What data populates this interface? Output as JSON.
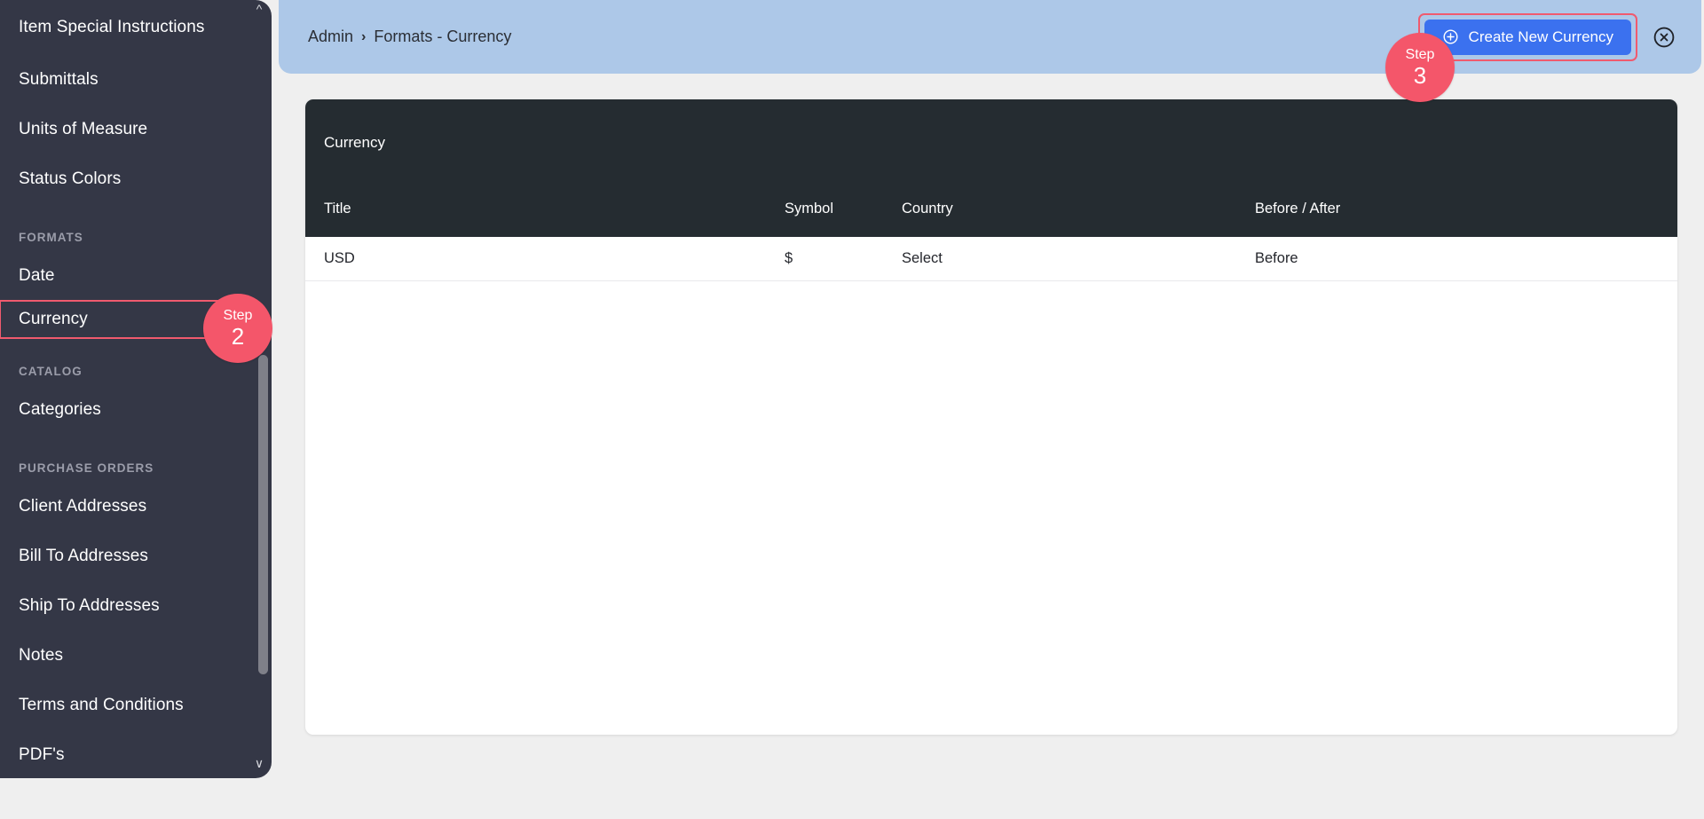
{
  "sidebar": {
    "items": [
      {
        "label": "Item Special Instructions",
        "type": "item",
        "name": "sidebar-item-item-special-instructions"
      },
      {
        "label": "Submittals",
        "type": "item",
        "name": "sidebar-item-submittals"
      },
      {
        "label": "Units of Measure",
        "type": "item",
        "name": "sidebar-item-units-of-measure"
      },
      {
        "label": "Status Colors",
        "type": "item",
        "name": "sidebar-item-status-colors"
      },
      {
        "label": "FORMATS",
        "type": "section",
        "name": "sidebar-section-formats"
      },
      {
        "label": "Date",
        "type": "item",
        "name": "sidebar-item-date"
      },
      {
        "label": "Currency",
        "type": "item",
        "highlighted": true,
        "name": "sidebar-item-currency"
      },
      {
        "label": "CATALOG",
        "type": "section",
        "name": "sidebar-section-catalog"
      },
      {
        "label": "Categories",
        "type": "item",
        "name": "sidebar-item-categories"
      },
      {
        "label": "PURCHASE ORDERS",
        "type": "section",
        "name": "sidebar-section-purchase-orders"
      },
      {
        "label": "Client Addresses",
        "type": "item",
        "name": "sidebar-item-client-addresses"
      },
      {
        "label": "Bill To Addresses",
        "type": "item",
        "name": "sidebar-item-bill-to-addresses"
      },
      {
        "label": "Ship To Addresses",
        "type": "item",
        "name": "sidebar-item-ship-to-addresses"
      },
      {
        "label": "Notes",
        "type": "item",
        "name": "sidebar-item-notes"
      },
      {
        "label": "Terms and Conditions",
        "type": "item",
        "name": "sidebar-item-terms-and-conditions"
      },
      {
        "label": "PDF's",
        "type": "item",
        "name": "sidebar-item-pdfs"
      }
    ]
  },
  "header": {
    "breadcrumb": {
      "root": "Admin",
      "separator": "›",
      "current": "Formats - Currency"
    },
    "create_button_label": "Create New Currency",
    "create_button_icon": "plus-circle-icon",
    "close_icon": "close-circle-icon",
    "accent_color": "#3b71ef",
    "bar_color": "#adc8e8",
    "highlight_color": "#f05a6e"
  },
  "card": {
    "title": "Currency",
    "columns": [
      {
        "label": "Title"
      },
      {
        "label": "Symbol"
      },
      {
        "label": "Country"
      },
      {
        "label": "Before / After"
      }
    ],
    "rows": [
      {
        "title": "USD",
        "symbol": "$",
        "country": "Select",
        "before_after": "Before"
      }
    ]
  },
  "steps": [
    {
      "word": "Step",
      "number": "2",
      "target": "sidebar-item-currency"
    },
    {
      "word": "Step",
      "number": "3",
      "target": "create-new-currency-button"
    }
  ]
}
